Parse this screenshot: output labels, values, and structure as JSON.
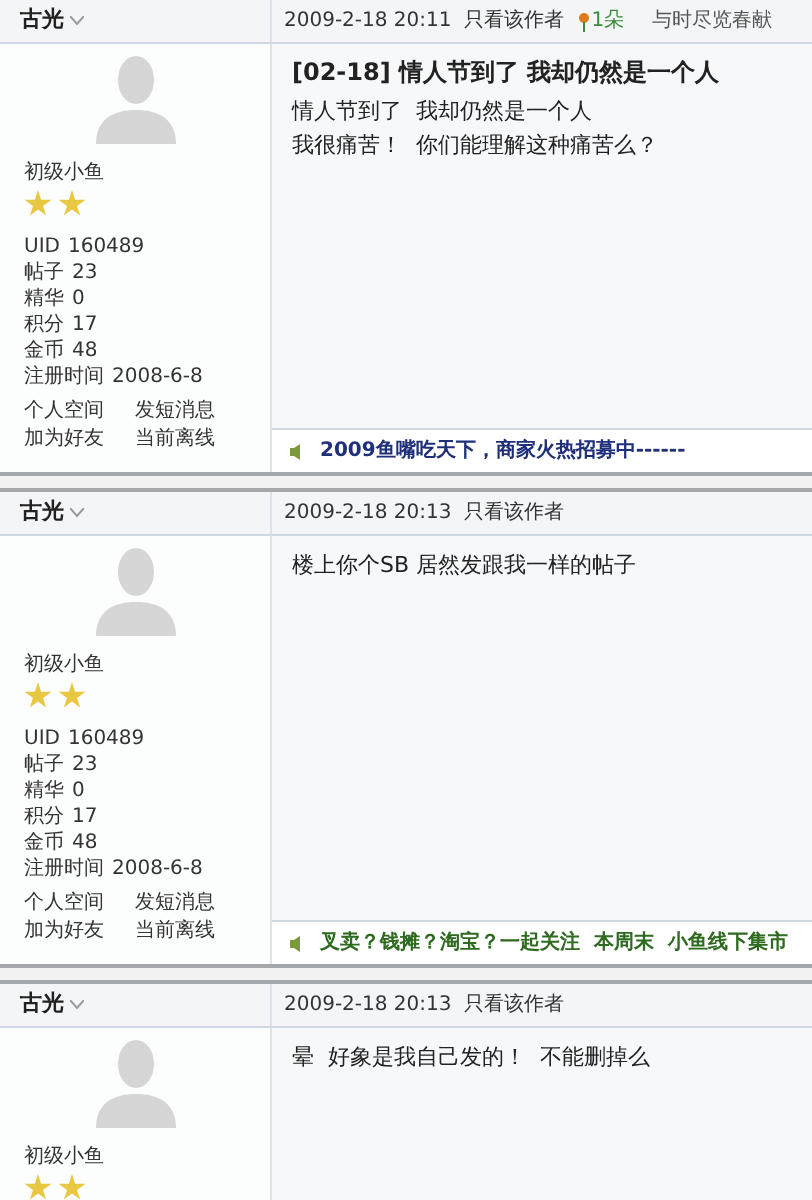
{
  "posts": [
    {
      "author": "古光",
      "time": "2009-2-18 20:11",
      "author_only_link": "只看该作者",
      "flower": "1朵",
      "extra": "与时尽览春献",
      "rank": "初级小鱼",
      "rank_icons": [
        {
          "kind": "star"
        },
        {
          "kind": "star"
        }
      ],
      "stats": [
        {
          "label": "UID",
          "value": "160489"
        },
        {
          "label": "帖子",
          "value": "23"
        },
        {
          "label": "精华",
          "value": "0"
        },
        {
          "label": "积分",
          "value": "17"
        },
        {
          "label": "金币",
          "value": "48"
        },
        {
          "label": "注册时间",
          "value": "2008-6-8"
        }
      ],
      "links": [
        "个人空间",
        "发短消息",
        "加为好友",
        "当前离线"
      ],
      "title": "[02-18] 情人节到了  我却仍然是一个人",
      "body": [
        "情人节到了  我却仍然是一个人",
        "我很痛苦！  你们能理解这种痛苦么？"
      ],
      "ad": {
        "text": "2009鱼嘴吃天下，商家火热招募中------",
        "color": "#1f2f7a"
      }
    },
    {
      "author": "古光",
      "time": "2009-2-18 20:13",
      "author_only_link": "只看该作者",
      "rank": "初级小鱼",
      "rank_icons": [
        {
          "kind": "star"
        },
        {
          "kind": "star"
        }
      ],
      "stats": [
        {
          "label": "UID",
          "value": "160489"
        },
        {
          "label": "帖子",
          "value": "23"
        },
        {
          "label": "精华",
          "value": "0"
        },
        {
          "label": "积分",
          "value": "17"
        },
        {
          "label": "金币",
          "value": "48"
        },
        {
          "label": "注册时间",
          "value": "2008-6-8"
        }
      ],
      "links": [
        "个人空间",
        "发短消息",
        "加为好友",
        "当前离线"
      ],
      "body": [
        "楼上你个SB 居然发跟我一样的帖子"
      ],
      "ad": {
        "text": "叉卖？钱摊？淘宝？一起关注  本周末  小鱼线下集市",
        "color": "#2e6b1f"
      }
    },
    {
      "author": "古光",
      "time": "2009-2-18 20:13",
      "author_only_link": "只看该作者",
      "rank": "初级小鱼",
      "rank_icons": [
        {
          "kind": "star"
        },
        {
          "kind": "star"
        }
      ],
      "body": [
        "晕  好象是我自己发的！  不能删掉么"
      ]
    }
  ]
}
